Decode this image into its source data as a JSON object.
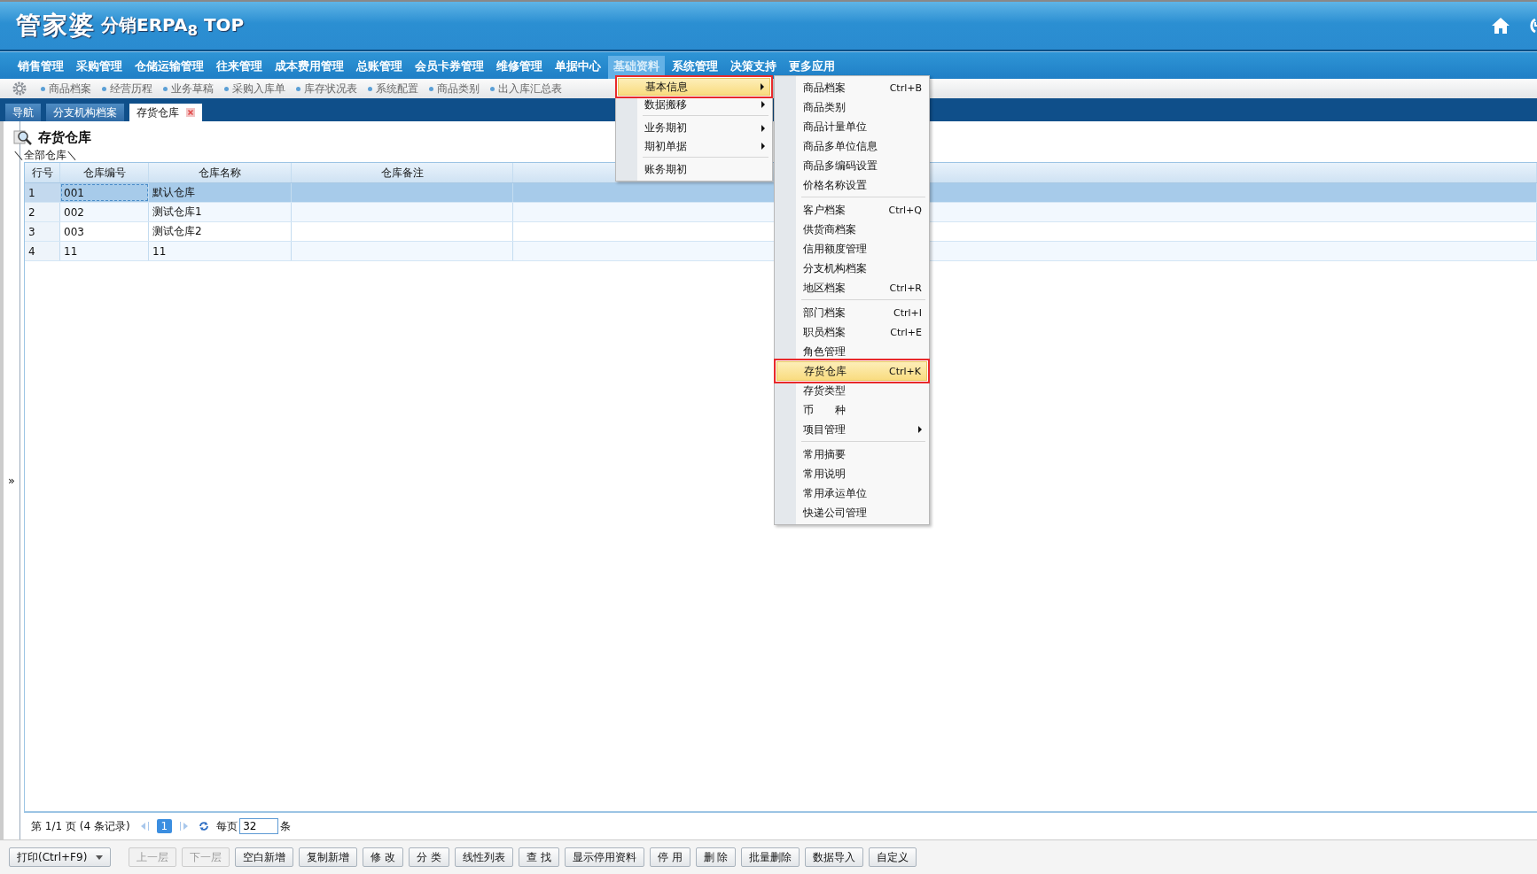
{
  "header": {
    "logo": "管家婆",
    "product": "分销ERPA$_{8}$ TOP"
  },
  "menu_bar": [
    {
      "label": "销售管理",
      "selected": false
    },
    {
      "label": "采购管理",
      "selected": false
    },
    {
      "label": "仓储运输管理",
      "selected": false
    },
    {
      "label": "往来管理",
      "selected": false
    },
    {
      "label": "成本费用管理",
      "selected": false
    },
    {
      "label": "总账管理",
      "selected": false
    },
    {
      "label": "会员卡券管理",
      "selected": false
    },
    {
      "label": "维修管理",
      "selected": false
    },
    {
      "label": "单据中心",
      "selected": false
    },
    {
      "label": "基础资料",
      "selected": true
    },
    {
      "label": "系统管理",
      "selected": false
    },
    {
      "label": "决策支持",
      "selected": false
    },
    {
      "label": "更多应用",
      "selected": false
    }
  ],
  "quick_links": [
    "商品档案",
    "经营历程",
    "业务草稿",
    "采购入库单",
    "库存状况表",
    "系统配置",
    "商品类别",
    "出入库汇总表"
  ],
  "tabs": [
    {
      "label": "导航",
      "selected": false,
      "closable": false
    },
    {
      "label": "分支机构档案",
      "selected": false,
      "closable": false
    },
    {
      "label": "存货仓库",
      "selected": true,
      "closable": true
    }
  ],
  "page": {
    "title": "存货仓库",
    "breadcrumb": "＼全部仓库＼"
  },
  "table": {
    "columns": [
      "行号",
      "仓库编号",
      "仓库名称",
      "仓库备注"
    ],
    "rows": [
      {
        "no": "1",
        "code": "001",
        "name": "默认仓库",
        "selected": true
      },
      {
        "no": "2",
        "code": "002",
        "name": "测试仓库1",
        "selected": false
      },
      {
        "no": "3",
        "code": "003",
        "name": "测试仓库2",
        "selected": false
      },
      {
        "no": "4",
        "code": "11",
        "name": "11",
        "selected": false
      }
    ]
  },
  "side_toggle": "»",
  "pagination": {
    "summary": "第  1/1 页  (4 条记录)",
    "page": "1",
    "per_page_label": "每页",
    "per_page": "32",
    "unit": "条"
  },
  "toolbar": [
    {
      "label": "打印(Ctrl+F9)",
      "kind": "dropdown",
      "disabled": false
    },
    {
      "label": "上一层",
      "kind": "button",
      "disabled": true
    },
    {
      "label": "下一层",
      "kind": "button",
      "disabled": true
    },
    {
      "label": "空白新增",
      "kind": "button",
      "disabled": false
    },
    {
      "label": "复制新增",
      "kind": "button",
      "disabled": false
    },
    {
      "label": "修 改",
      "kind": "button",
      "disabled": false
    },
    {
      "label": "分 类",
      "kind": "button",
      "disabled": false
    },
    {
      "label": "线性列表",
      "kind": "button",
      "disabled": false
    },
    {
      "label": "查 找",
      "kind": "button",
      "disabled": false
    },
    {
      "label": "显示停用资料",
      "kind": "button",
      "disabled": false
    },
    {
      "label": "停 用",
      "kind": "button",
      "disabled": false
    },
    {
      "label": "删 除",
      "kind": "button",
      "disabled": false
    },
    {
      "label": "批量删除",
      "kind": "button",
      "disabled": false
    },
    {
      "label": "数据导入",
      "kind": "button",
      "disabled": false
    },
    {
      "label": "自定义",
      "kind": "button",
      "disabled": false
    }
  ],
  "menu": [
    {
      "label": "基本信息",
      "selected": true,
      "outlined": true,
      "arrow": true,
      "separator_before": false
    },
    {
      "label": "数据搬移",
      "selected": false,
      "outlined": false,
      "arrow": true,
      "separator_before": false
    },
    {
      "label": "业务期初",
      "selected": false,
      "outlined": false,
      "arrow": true,
      "separator_before": true
    },
    {
      "label": "期初单据",
      "selected": false,
      "outlined": false,
      "arrow": true,
      "separator_before": false
    },
    {
      "label": "账务期初",
      "selected": false,
      "outlined": false,
      "arrow": false,
      "separator_before": true
    }
  ],
  "submenu": [
    {
      "label": "商品档案",
      "shortcut": "Ctrl+B",
      "selected": false,
      "outlined": false,
      "arrow": false,
      "separator_before": false
    },
    {
      "label": "商品类别",
      "selected": false,
      "outlined": false,
      "arrow": false,
      "separator_before": false
    },
    {
      "label": "商品计量单位",
      "selected": false,
      "outlined": false,
      "arrow": false,
      "separator_before": false
    },
    {
      "label": "商品多单位信息",
      "selected": false,
      "outlined": false,
      "arrow": false,
      "separator_before": false
    },
    {
      "label": "商品多编码设置",
      "selected": false,
      "outlined": false,
      "arrow": false,
      "separator_before": false
    },
    {
      "label": "价格名称设置",
      "selected": false,
      "outlined": false,
      "arrow": false,
      "separator_before": false
    },
    {
      "label": "客户档案",
      "shortcut": "Ctrl+Q",
      "selected": false,
      "outlined": false,
      "arrow": false,
      "separator_before": true
    },
    {
      "label": "供货商档案",
      "selected": false,
      "outlined": false,
      "arrow": false,
      "separator_before": false
    },
    {
      "label": "信用额度管理",
      "selected": false,
      "outlined": false,
      "arrow": false,
      "separator_before": false
    },
    {
      "label": "分支机构档案",
      "selected": false,
      "outlined": false,
      "arrow": false,
      "separator_before": false
    },
    {
      "label": "地区档案",
      "shortcut": "Ctrl+R",
      "selected": false,
      "outlined": false,
      "arrow": false,
      "separator_before": false
    },
    {
      "label": "部门档案",
      "shortcut": "Ctrl+I",
      "selected": false,
      "outlined": false,
      "arrow": false,
      "separator_before": true
    },
    {
      "label": "职员档案",
      "shortcut": "Ctrl+E",
      "selected": false,
      "outlined": false,
      "arrow": false,
      "separator_before": false
    },
    {
      "label": "角色管理",
      "selected": false,
      "outlined": false,
      "arrow": false,
      "separator_before": false
    },
    {
      "label": "存货仓库",
      "shortcut": "Ctrl+K",
      "selected": true,
      "outlined": true,
      "arrow": false,
      "separator_before": false
    },
    {
      "label": "存货类型",
      "selected": false,
      "outlined": false,
      "arrow": false,
      "separator_before": false
    },
    {
      "label": "币　　种",
      "selected": false,
      "outlined": false,
      "arrow": false,
      "separator_before": false
    },
    {
      "label": "项目管理",
      "selected": false,
      "outlined": false,
      "arrow": true,
      "separator_before": false
    },
    {
      "label": "常用摘要",
      "selected": false,
      "outlined": false,
      "arrow": false,
      "separator_before": true
    },
    {
      "label": "常用说明",
      "selected": false,
      "outlined": false,
      "arrow": false,
      "separator_before": false
    },
    {
      "label": "常用承运单位",
      "selected": false,
      "outlined": false,
      "arrow": false,
      "separator_before": false
    },
    {
      "label": "快递公司管理",
      "selected": false,
      "outlined": false,
      "arrow": false,
      "separator_before": false
    }
  ]
}
